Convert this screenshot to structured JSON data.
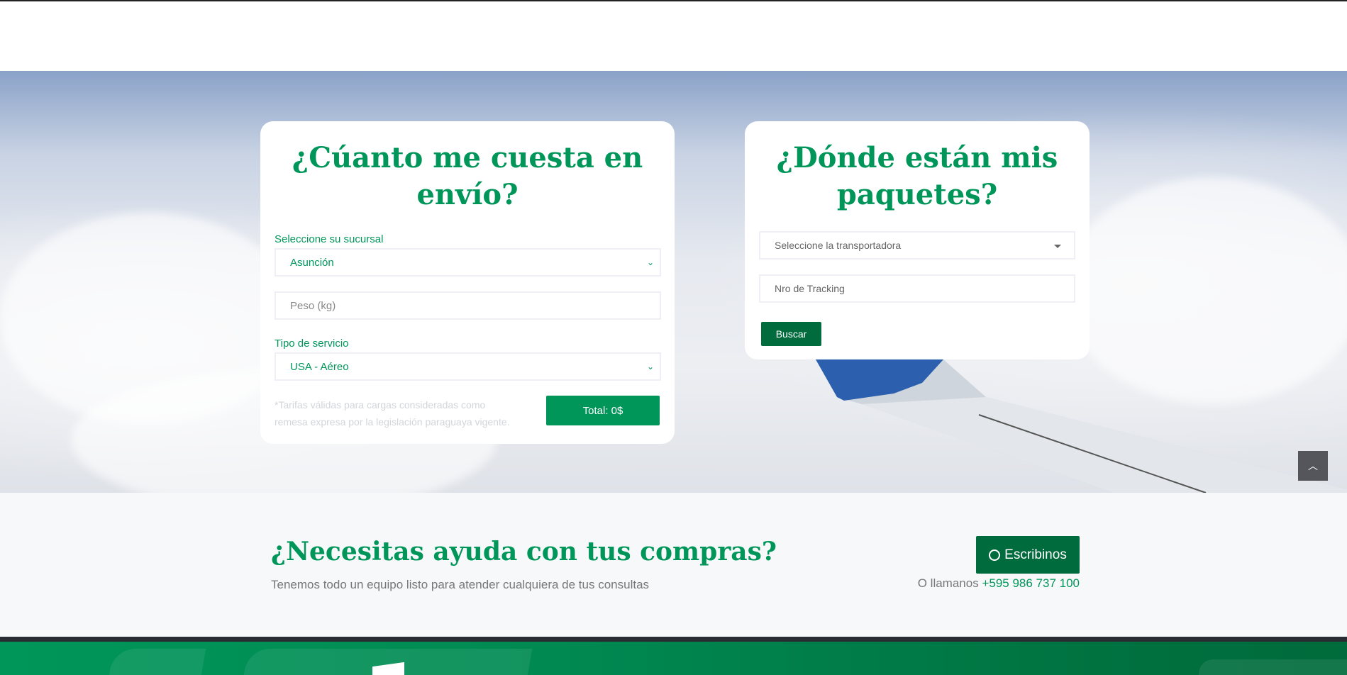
{
  "cost_card": {
    "title": "¿Cúanto me cuesta en envío?",
    "branch_label": "Seleccione su sucursal",
    "branch_value": "Asunción",
    "weight_placeholder": "Peso (kg)",
    "service_label": "Tipo de servicio",
    "service_value": "USA - Aéreo",
    "note": "*Tarifas válidas para cargas consideradas como remesa expresa por la legislación paraguaya vigente.",
    "total_button": "Total: 0$"
  },
  "tracking_card": {
    "title": "¿Dónde están mis paquetes?",
    "carrier_placeholder": "Seleccione la transportadora",
    "tracking_placeholder": "Nro de Tracking",
    "search_button": "Buscar"
  },
  "help": {
    "title": "¿Necesitas ayuda con tus compras?",
    "subtitle": "Tenemos todo un equipo listo para atender cualquiera de tus consultas",
    "write_button": "Escribinos",
    "call_prefix": "O llamanos",
    "phone": "+595 986 737 100"
  },
  "colors": {
    "brand": "#00965a",
    "dark_green": "#006b3c"
  }
}
